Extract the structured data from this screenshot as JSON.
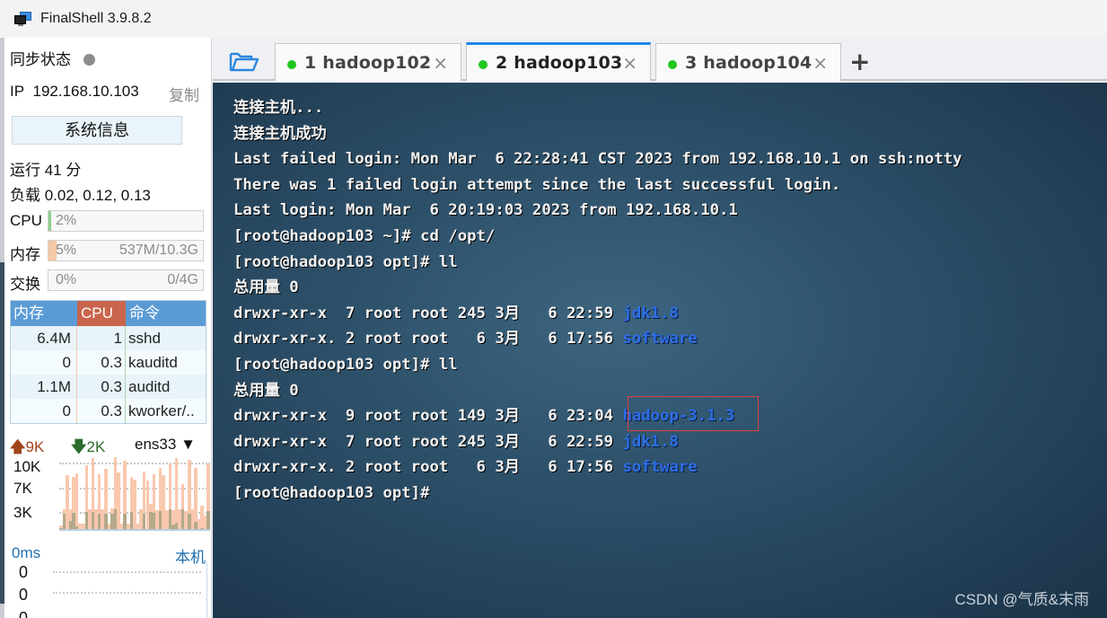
{
  "window": {
    "title": "FinalShell 3.9.8.2",
    "icon": "monitor-icon"
  },
  "sidebar": {
    "sync_label": "同步状态",
    "sync_status_color": "#8c8c8c",
    "ip_label": "IP",
    "ip_value": "192.168.10.103",
    "copy_label": "复制",
    "sysinfo_button": "系统信息",
    "uptime": "运行 41 分",
    "load": "负载 0.02, 0.12, 0.13",
    "cpu": {
      "label": "CPU",
      "percent_text": "2%",
      "fraction": 0.02,
      "color": "#8ccf8c"
    },
    "memory": {
      "label": "内存",
      "percent_text": "5%",
      "fraction": 0.05,
      "detail": "537M/10.3G",
      "color": "#f6c9a6"
    },
    "swap": {
      "label": "交换",
      "percent_text": "0%",
      "fraction": 0.0,
      "detail": "0/4G"
    },
    "process_table": {
      "headers": {
        "mem": "内存",
        "cpu": "CPU",
        "cmd": "命令"
      },
      "rows": [
        {
          "mem": "6.4M",
          "cpu": "1",
          "cmd": "sshd"
        },
        {
          "mem": "0",
          "cpu": "0.3",
          "cmd": "kauditd"
        },
        {
          "mem": "1.1M",
          "cpu": "0.3",
          "cmd": "auditd"
        },
        {
          "mem": "0",
          "cpu": "0.3",
          "cmd": "kworker/.."
        }
      ]
    },
    "network": {
      "upload": "9K",
      "download": "2K",
      "interface": "ens33",
      "y_labels": [
        "10K",
        "7K",
        "3K"
      ],
      "chart_data": {
        "type": "bar",
        "title": "",
        "xlabel": "",
        "ylabel": "",
        "ylim": [
          0,
          11000
        ],
        "series": [
          {
            "name": "upload",
            "color": "#f9c8ae",
            "values": [
              500,
              3000,
              8200,
              3000,
              8000,
              8500,
              800,
              800,
              9800,
              3000,
              10800,
              3000,
              8400,
              3000,
              9200,
              800,
              3200,
              11000,
              8600,
              800,
              10400,
              800,
              8000,
              7600,
              800,
              3000,
              8800,
              7400,
              3800,
              8400,
              2900,
              9400,
              8300,
              2900,
              10100,
              2900,
              10800,
              3000,
              6900,
              2700,
              10600,
              3000,
              9400,
              1500,
              3600,
              2000,
              10100
            ]
          },
          {
            "name": "download",
            "color": "#b3a98a",
            "values": [
              100,
              2300,
              0,
              1200,
              2500,
              400,
              0,
              0,
              2600,
              0,
              2600,
              0,
              2300,
              0,
              2300,
              0,
              2300,
              3000,
              0,
              0,
              2300,
              0,
              2600,
              0,
              0,
              0,
              2300,
              0,
              2600,
              2500,
              0,
              2700,
              0,
              0,
              3000,
              700,
              1000,
              0,
              3000,
              0,
              2300,
              0,
              1100,
              0,
              200,
              0,
              2700
            ]
          }
        ]
      }
    },
    "ping": {
      "latency": "0ms",
      "target": "本机",
      "y_labels": [
        "0",
        "0",
        "0"
      ]
    }
  },
  "tabs": {
    "folder_icon": "folder-icon",
    "items": [
      {
        "label": "1 hadoop102",
        "status_color": "#1fc61f",
        "active": false
      },
      {
        "label": "2 hadoop103",
        "status_color": "#1fc61f",
        "active": true
      },
      {
        "label": "3 hadoop104",
        "status_color": "#1fc61f",
        "active": false
      }
    ],
    "close_symbol": "×",
    "add_symbol": "+"
  },
  "terminal": {
    "lines": [
      {
        "text": "连接主机..."
      },
      {
        "text": "连接主机成功"
      },
      {
        "text": "Last failed login: Mon Mar  6 22:28:41 CST 2023 from 192.168.10.1 on ssh:notty"
      },
      {
        "text": "There was 1 failed login attempt since the last successful login."
      },
      {
        "text": "Last login: Mon Mar  6 20:19:03 2023 from 192.168.10.1"
      },
      {
        "text": "[root@hadoop103 ~]# cd /opt/"
      },
      {
        "text": "[root@hadoop103 opt]# ll"
      },
      {
        "text": "总用量 0"
      },
      {
        "text": "drwxr-xr-x  7 root root 245 3月   6 22:59 ",
        "dir": "jdk1.8"
      },
      {
        "text": "drwxr-xr-x. 2 root root   6 3月   6 17:56 ",
        "dir": "software"
      },
      {
        "text": "[root@hadoop103 opt]# ll"
      },
      {
        "text": "总用量 0"
      },
      {
        "text": "drwxr-xr-x  9 root root 149 3月   6 23:04 ",
        "dir": "hadoop-3.1.3"
      },
      {
        "text": "drwxr-xr-x  7 root root 245 3月   6 22:59 ",
        "dir": "jdk1.8"
      },
      {
        "text": "drwxr-xr-x. 2 root root   6 3月   6 17:56 ",
        "dir": "software"
      },
      {
        "text": "[root@hadoop103 opt]#"
      }
    ],
    "highlighted_entry": "hadoop-3.1.3",
    "watermark": "CSDN @气质&末雨"
  }
}
